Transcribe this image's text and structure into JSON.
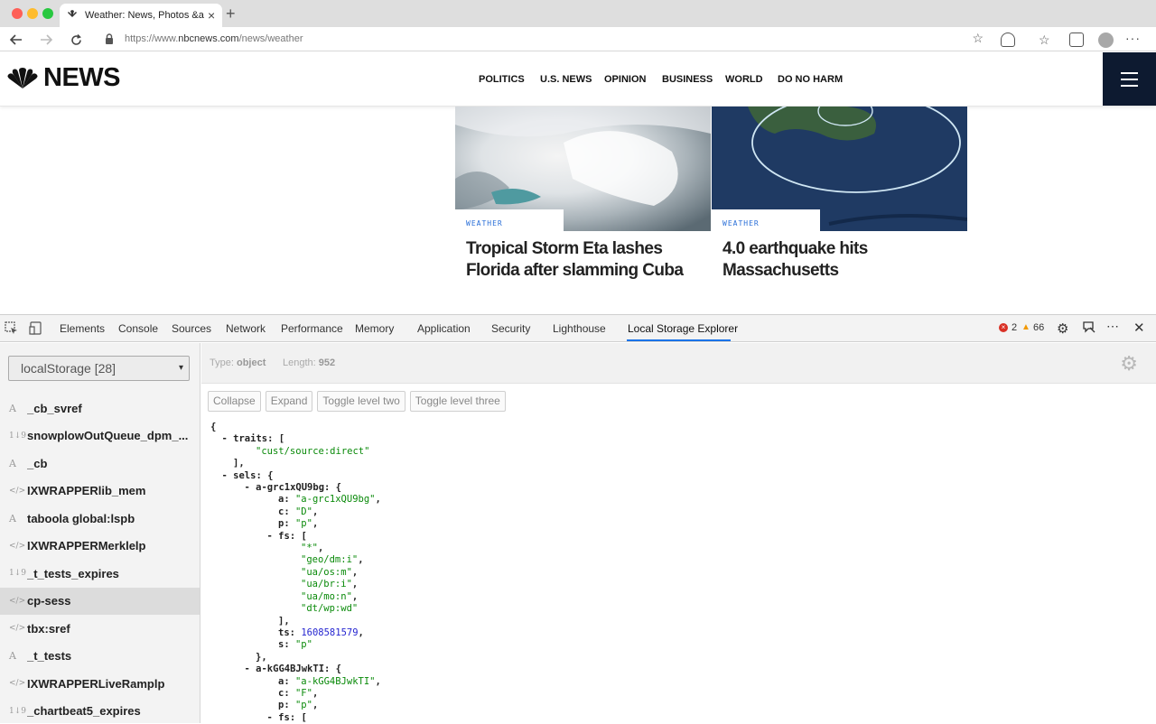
{
  "browser": {
    "tab_title": "Weather: News, Photos &amp; ...",
    "tab_close": "×",
    "new_tab": "+",
    "url_prefix": "https://www.",
    "url_domain": "nbcnews.com",
    "url_path": "/news/weather"
  },
  "nbc": {
    "logo_text": "NEWS",
    "nav": [
      "POLITICS",
      "U.S. NEWS",
      "OPINION",
      "BUSINESS",
      "WORLD",
      "DO NO HARM"
    ],
    "cards": [
      {
        "label": "WEATHER",
        "headline": "Tropical Storm Eta lashes Florida after slamming Cuba"
      },
      {
        "label": "WEATHER",
        "headline": "4.0 earthquake hits Massachusetts"
      }
    ]
  },
  "devtools": {
    "tabs": [
      "Elements",
      "Console",
      "Sources",
      "Network",
      "Performance",
      "Memory",
      "Application",
      "Security",
      "Lighthouse",
      "Local Storage Explorer"
    ],
    "active_tab": "Local Storage Explorer",
    "errors": "2",
    "warnings": "66",
    "colors": {
      "accent": "#1a73e8",
      "error": "#d93025",
      "warning": "#f29900"
    }
  },
  "storage": {
    "selector": "localStorage [28]",
    "type_label": "Type:",
    "type_value": "object",
    "length_label": "Length:",
    "length_value": "952",
    "buttons": [
      "Collapse",
      "Expand",
      "Toggle level two",
      "Toggle level three"
    ],
    "items": [
      {
        "type": "text",
        "icon": "A",
        "name": "_cb_svref"
      },
      {
        "type": "number",
        "icon": "1↓9",
        "name": "snowplowOutQueue_dpm_..."
      },
      {
        "type": "text",
        "icon": "A",
        "name": "_cb"
      },
      {
        "type": "code",
        "icon": "</>",
        "name": "IXWRAPPERlib_mem"
      },
      {
        "type": "text",
        "icon": "A",
        "name": "taboola global:lspb"
      },
      {
        "type": "code",
        "icon": "</>",
        "name": "IXWRAPPERMerklelp"
      },
      {
        "type": "number",
        "icon": "1↓9",
        "name": "_t_tests_expires"
      },
      {
        "type": "code",
        "icon": "</>",
        "name": "cp-sess",
        "selected": true
      },
      {
        "type": "code",
        "icon": "</>",
        "name": "tbx:sref"
      },
      {
        "type": "text",
        "icon": "A",
        "name": "_t_tests"
      },
      {
        "type": "code",
        "icon": "</>",
        "name": "IXWRAPPERLiveRamplp"
      },
      {
        "type": "number",
        "icon": "1↓9",
        "name": "_chartbeat5_expires"
      }
    ]
  },
  "json_lines": [
    {
      "indent": 0,
      "parts": [
        {
          "c": "jt",
          "t": "{"
        }
      ]
    },
    {
      "indent": 1,
      "parts": [
        {
          "c": "jt",
          "t": "- "
        },
        {
          "c": "jk",
          "t": "traits"
        },
        {
          "c": "jt",
          "t": ": ["
        }
      ]
    },
    {
      "indent": 4,
      "parts": [
        {
          "c": "js",
          "t": "\"cust/source:direct\""
        }
      ]
    },
    {
      "indent": 2,
      "parts": [
        {
          "c": "jt",
          "t": "],"
        }
      ]
    },
    {
      "indent": 1,
      "parts": [
        {
          "c": "jt",
          "t": "- "
        },
        {
          "c": "jk",
          "t": "sels"
        },
        {
          "c": "jt",
          "t": ": {"
        }
      ]
    },
    {
      "indent": 3,
      "parts": [
        {
          "c": "jt",
          "t": "- "
        },
        {
          "c": "jk",
          "t": "a-grc1xQU9bg"
        },
        {
          "c": "jt",
          "t": ": {"
        }
      ]
    },
    {
      "indent": 6,
      "parts": [
        {
          "c": "jk",
          "t": "a"
        },
        {
          "c": "jt",
          "t": ": "
        },
        {
          "c": "js",
          "t": "\"a-grc1xQU9bg\""
        },
        {
          "c": "jt",
          "t": ","
        }
      ]
    },
    {
      "indent": 6,
      "parts": [
        {
          "c": "jk",
          "t": "c"
        },
        {
          "c": "jt",
          "t": ": "
        },
        {
          "c": "js",
          "t": "\"D\""
        },
        {
          "c": "jt",
          "t": ","
        }
      ]
    },
    {
      "indent": 6,
      "parts": [
        {
          "c": "jk",
          "t": "p"
        },
        {
          "c": "jt",
          "t": ": "
        },
        {
          "c": "js",
          "t": "\"p\""
        },
        {
          "c": "jt",
          "t": ","
        }
      ]
    },
    {
      "indent": 5,
      "parts": [
        {
          "c": "jt",
          "t": "- "
        },
        {
          "c": "jk",
          "t": "fs"
        },
        {
          "c": "jt",
          "t": ": ["
        }
      ]
    },
    {
      "indent": 8,
      "parts": [
        {
          "c": "js",
          "t": "\"*\""
        },
        {
          "c": "jt",
          "t": ","
        }
      ]
    },
    {
      "indent": 8,
      "parts": [
        {
          "c": "js",
          "t": "\"geo/dm:i\""
        },
        {
          "c": "jt",
          "t": ","
        }
      ]
    },
    {
      "indent": 8,
      "parts": [
        {
          "c": "js",
          "t": "\"ua/os:m\""
        },
        {
          "c": "jt",
          "t": ","
        }
      ]
    },
    {
      "indent": 8,
      "parts": [
        {
          "c": "js",
          "t": "\"ua/br:i\""
        },
        {
          "c": "jt",
          "t": ","
        }
      ]
    },
    {
      "indent": 8,
      "parts": [
        {
          "c": "js",
          "t": "\"ua/mo:n\""
        },
        {
          "c": "jt",
          "t": ","
        }
      ]
    },
    {
      "indent": 8,
      "parts": [
        {
          "c": "js",
          "t": "\"dt/wp:wd\""
        }
      ]
    },
    {
      "indent": 6,
      "parts": [
        {
          "c": "jt",
          "t": "],"
        }
      ]
    },
    {
      "indent": 6,
      "parts": [
        {
          "c": "jk",
          "t": "ts"
        },
        {
          "c": "jt",
          "t": ": "
        },
        {
          "c": "jn",
          "t": "1608581579"
        },
        {
          "c": "jt",
          "t": ","
        }
      ]
    },
    {
      "indent": 6,
      "parts": [
        {
          "c": "jk",
          "t": "s"
        },
        {
          "c": "jt",
          "t": ": "
        },
        {
          "c": "js",
          "t": "\"p\""
        }
      ]
    },
    {
      "indent": 4,
      "parts": [
        {
          "c": "jt",
          "t": "},"
        }
      ]
    },
    {
      "indent": 3,
      "parts": [
        {
          "c": "jt",
          "t": "- "
        },
        {
          "c": "jk",
          "t": "a-kGG4BJwkTI"
        },
        {
          "c": "jt",
          "t": ": {"
        }
      ]
    },
    {
      "indent": 6,
      "parts": [
        {
          "c": "jk",
          "t": "a"
        },
        {
          "c": "jt",
          "t": ": "
        },
        {
          "c": "js",
          "t": "\"a-kGG4BJwkTI\""
        },
        {
          "c": "jt",
          "t": ","
        }
      ]
    },
    {
      "indent": 6,
      "parts": [
        {
          "c": "jk",
          "t": "c"
        },
        {
          "c": "jt",
          "t": ": "
        },
        {
          "c": "js",
          "t": "\"F\""
        },
        {
          "c": "jt",
          "t": ","
        }
      ]
    },
    {
      "indent": 6,
      "parts": [
        {
          "c": "jk",
          "t": "p"
        },
        {
          "c": "jt",
          "t": ": "
        },
        {
          "c": "js",
          "t": "\"p\""
        },
        {
          "c": "jt",
          "t": ","
        }
      ]
    },
    {
      "indent": 5,
      "parts": [
        {
          "c": "jt",
          "t": "- "
        },
        {
          "c": "jk",
          "t": "fs"
        },
        {
          "c": "jt",
          "t": ": ["
        }
      ]
    }
  ]
}
